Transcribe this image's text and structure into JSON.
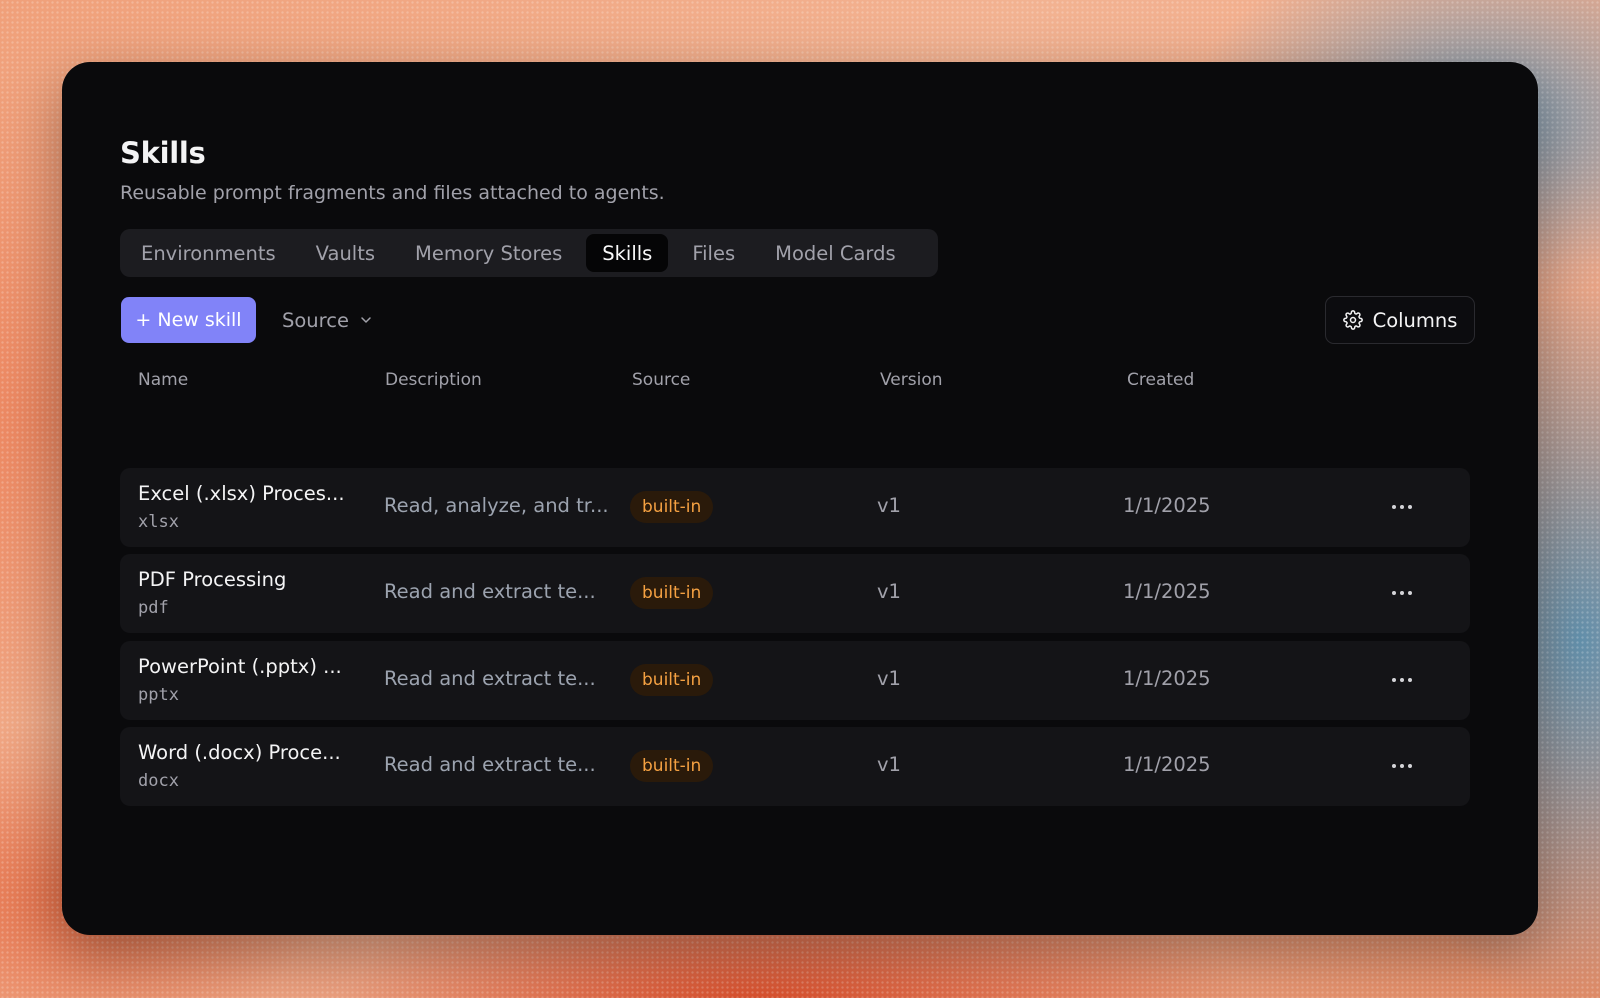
{
  "header": {
    "title": "Skills",
    "subtitle": "Reusable prompt fragments and files attached to agents."
  },
  "tabs": [
    {
      "label": "Environments",
      "active": false
    },
    {
      "label": "Vaults",
      "active": false
    },
    {
      "label": "Memory Stores",
      "active": false
    },
    {
      "label": "Skills",
      "active": true
    },
    {
      "label": "Files",
      "active": false
    },
    {
      "label": "Model Cards",
      "active": false
    }
  ],
  "toolbar": {
    "new_button": "+ New skill",
    "source_filter": "Source",
    "columns_button": "Columns"
  },
  "table": {
    "columns": [
      "Name",
      "Description",
      "Source",
      "Version",
      "Created"
    ],
    "rows": [
      {
        "name": "Excel (.xlsx) Proces...",
        "slug": "xlsx",
        "description": "Read, analyze, and tr...",
        "source": "built-in",
        "version": "v1",
        "created": "1/1/2025"
      },
      {
        "name": "PDF Processing",
        "slug": "pdf",
        "description": "Read and extract te...",
        "source": "built-in",
        "version": "v1",
        "created": "1/1/2025"
      },
      {
        "name": "PowerPoint (.pptx) ...",
        "slug": "pptx",
        "description": "Read and extract te...",
        "source": "built-in",
        "version": "v1",
        "created": "1/1/2025"
      },
      {
        "name": "Word (.docx) Proce...",
        "slug": "docx",
        "description": "Read and extract te...",
        "source": "built-in",
        "version": "v1",
        "created": "1/1/2025"
      }
    ]
  },
  "icons": {
    "columns": "gear-icon",
    "source_filter": "chevron-down-icon",
    "row_actions": "more-horizontal-icon"
  },
  "colors": {
    "accent": "#8183f8",
    "badge_text": "#f5a142",
    "badge_bg": "#2a1a0a",
    "card_bg": "#0a0a0c"
  }
}
